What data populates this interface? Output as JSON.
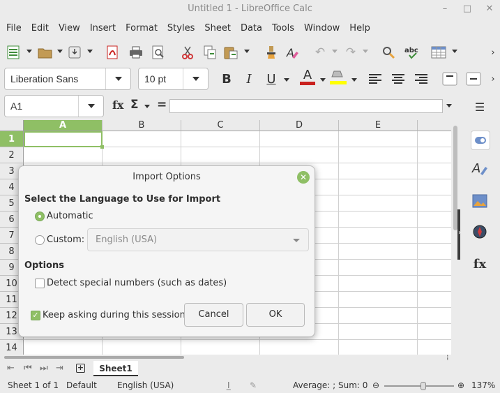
{
  "window": {
    "title": "Untitled 1 - LibreOffice Calc"
  },
  "menubar": {
    "items": [
      "File",
      "Edit",
      "View",
      "Insert",
      "Format",
      "Styles",
      "Sheet",
      "Data",
      "Tools",
      "Window",
      "Help"
    ]
  },
  "font": {
    "name": "Liberation Sans",
    "size": "10 pt"
  },
  "formula": {
    "cell_ref": "A1",
    "fx_label": "fx",
    "sum_label": "Σ",
    "equals_label": "="
  },
  "grid": {
    "columns": [
      "A",
      "B",
      "C",
      "D",
      "E"
    ],
    "rows": [
      "1",
      "2",
      "3",
      "4",
      "5",
      "6",
      "7",
      "8",
      "9",
      "10",
      "11",
      "12",
      "13",
      "14"
    ],
    "selected_color": "#8fbf65"
  },
  "sheet": {
    "tab_label": "Sheet1"
  },
  "status": {
    "sheet_of": "Sheet 1 of 1",
    "page_style": "Default",
    "language": "English (USA)",
    "selection_summary": "Average: ; Sum: 0",
    "zoom": "137%",
    "zoom_level_fraction": 0.56
  },
  "dialog": {
    "title": "Import Options",
    "section_language": "Select the Language to Use for Import",
    "automatic_label": "Automatic",
    "custom_label": "Custom:",
    "custom_value": "English (USA)",
    "section_options": "Options",
    "detect_label": "Detect special numbers (such as dates)",
    "keep_asking_label": "Keep asking during this session",
    "cancel_label": "Cancel",
    "ok_label": "OK",
    "automatic_selected": true,
    "detect_checked": false,
    "keep_asking_checked": true
  },
  "colors": {
    "accent": "#8fbf65",
    "cut_icon": "#d0393b",
    "font_color_bar": "#c9211e",
    "highlight_bar": "#ffff00"
  }
}
